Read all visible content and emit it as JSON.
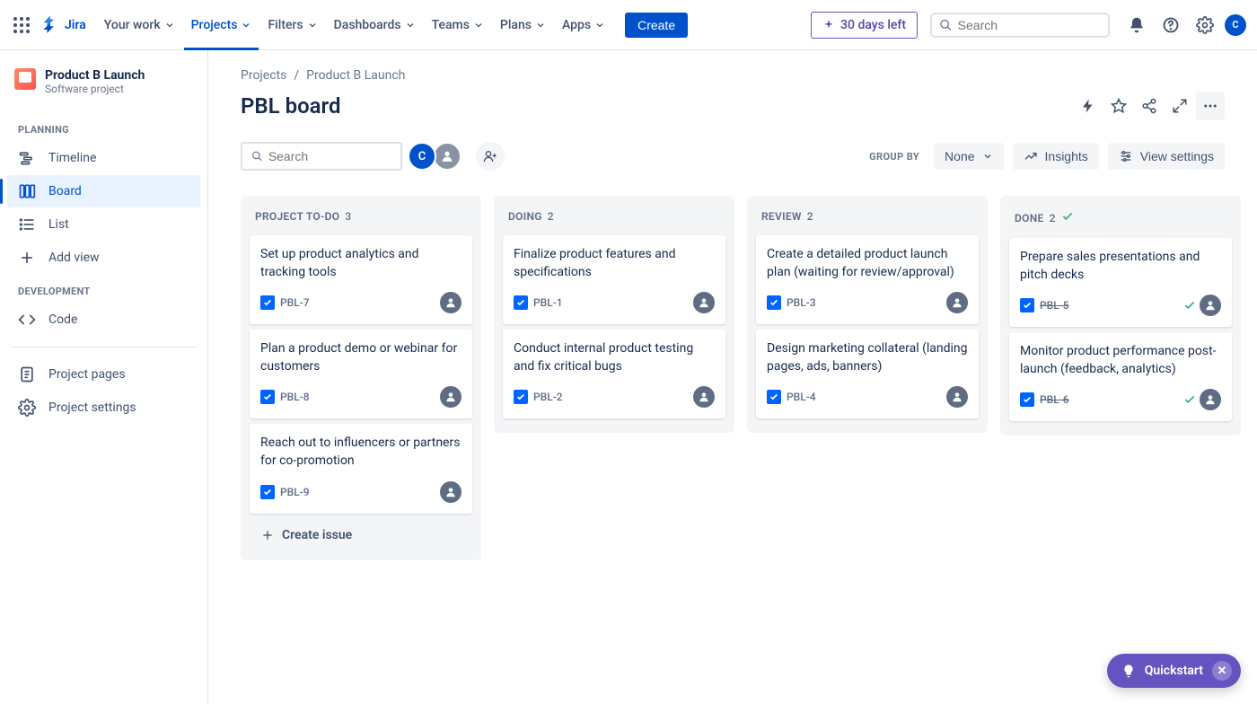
{
  "topnav": {
    "logo_text": "Jira",
    "items": [
      {
        "label": "Your work",
        "active": false
      },
      {
        "label": "Projects",
        "active": true
      },
      {
        "label": "Filters",
        "active": false
      },
      {
        "label": "Dashboards",
        "active": false
      },
      {
        "label": "Teams",
        "active": false
      },
      {
        "label": "Plans",
        "active": false
      },
      {
        "label": "Apps",
        "active": false
      }
    ],
    "create_label": "Create",
    "trial_label": "30 days left",
    "search_placeholder": "Search",
    "avatar_initial": "C"
  },
  "sidebar": {
    "project_name": "Product B Launch",
    "project_subtitle": "Software project",
    "sections": {
      "planning_label": "PLANNING",
      "development_label": "DEVELOPMENT",
      "planning_items": [
        {
          "label": "Timeline",
          "icon": "timeline"
        },
        {
          "label": "Board",
          "icon": "board",
          "selected": true
        },
        {
          "label": "List",
          "icon": "list"
        }
      ],
      "add_view_label": "Add view",
      "dev_items": [
        {
          "label": "Code",
          "icon": "code"
        }
      ],
      "bottom_items": [
        {
          "label": "Project pages",
          "icon": "page"
        },
        {
          "label": "Project settings",
          "icon": "gear"
        }
      ]
    }
  },
  "main": {
    "breadcrumb": {
      "projects": "Projects",
      "project": "Product B Launch"
    },
    "board_title": "PBL board",
    "search_placeholder": "Search",
    "avatar_initial": "C",
    "groupby_label": "GROUP BY",
    "groupby_value": "None",
    "insights_label": "Insights",
    "view_settings_label": "View settings",
    "create_issue_label": "Create issue"
  },
  "columns": [
    {
      "title": "PROJECT TO-DO",
      "count": "3",
      "done_col": false,
      "cards": [
        {
          "title": "Set up product analytics and tracking tools",
          "key": "PBL-7",
          "done": false
        },
        {
          "title": "Plan a product demo or webinar for customers",
          "key": "PBL-8",
          "done": false
        },
        {
          "title": "Reach out to influencers or partners for co-promotion",
          "key": "PBL-9",
          "done": false
        }
      ],
      "show_create": true
    },
    {
      "title": "DOING",
      "count": "2",
      "done_col": false,
      "cards": [
        {
          "title": "Finalize product features and specifications",
          "key": "PBL-1",
          "done": false
        },
        {
          "title": "Conduct internal product testing and fix critical bugs",
          "key": "PBL-2",
          "done": false
        }
      ],
      "show_create": false
    },
    {
      "title": "REVIEW",
      "count": "2",
      "done_col": false,
      "cards": [
        {
          "title": "Create a detailed product launch plan (waiting for review/approval)",
          "key": "PBL-3",
          "done": false
        },
        {
          "title": "Design marketing collateral (landing pages, ads, banners)",
          "key": "PBL-4",
          "done": false
        }
      ],
      "show_create": false
    },
    {
      "title": "DONE",
      "count": "2",
      "done_col": true,
      "cards": [
        {
          "title": "Prepare sales presentations and pitch decks",
          "key": "PBL-5",
          "done": true
        },
        {
          "title": "Monitor product performance post-launch (feedback, analytics)",
          "key": "PBL-6",
          "done": true
        }
      ],
      "show_create": false
    }
  ],
  "quickstart_label": "Quickstart"
}
